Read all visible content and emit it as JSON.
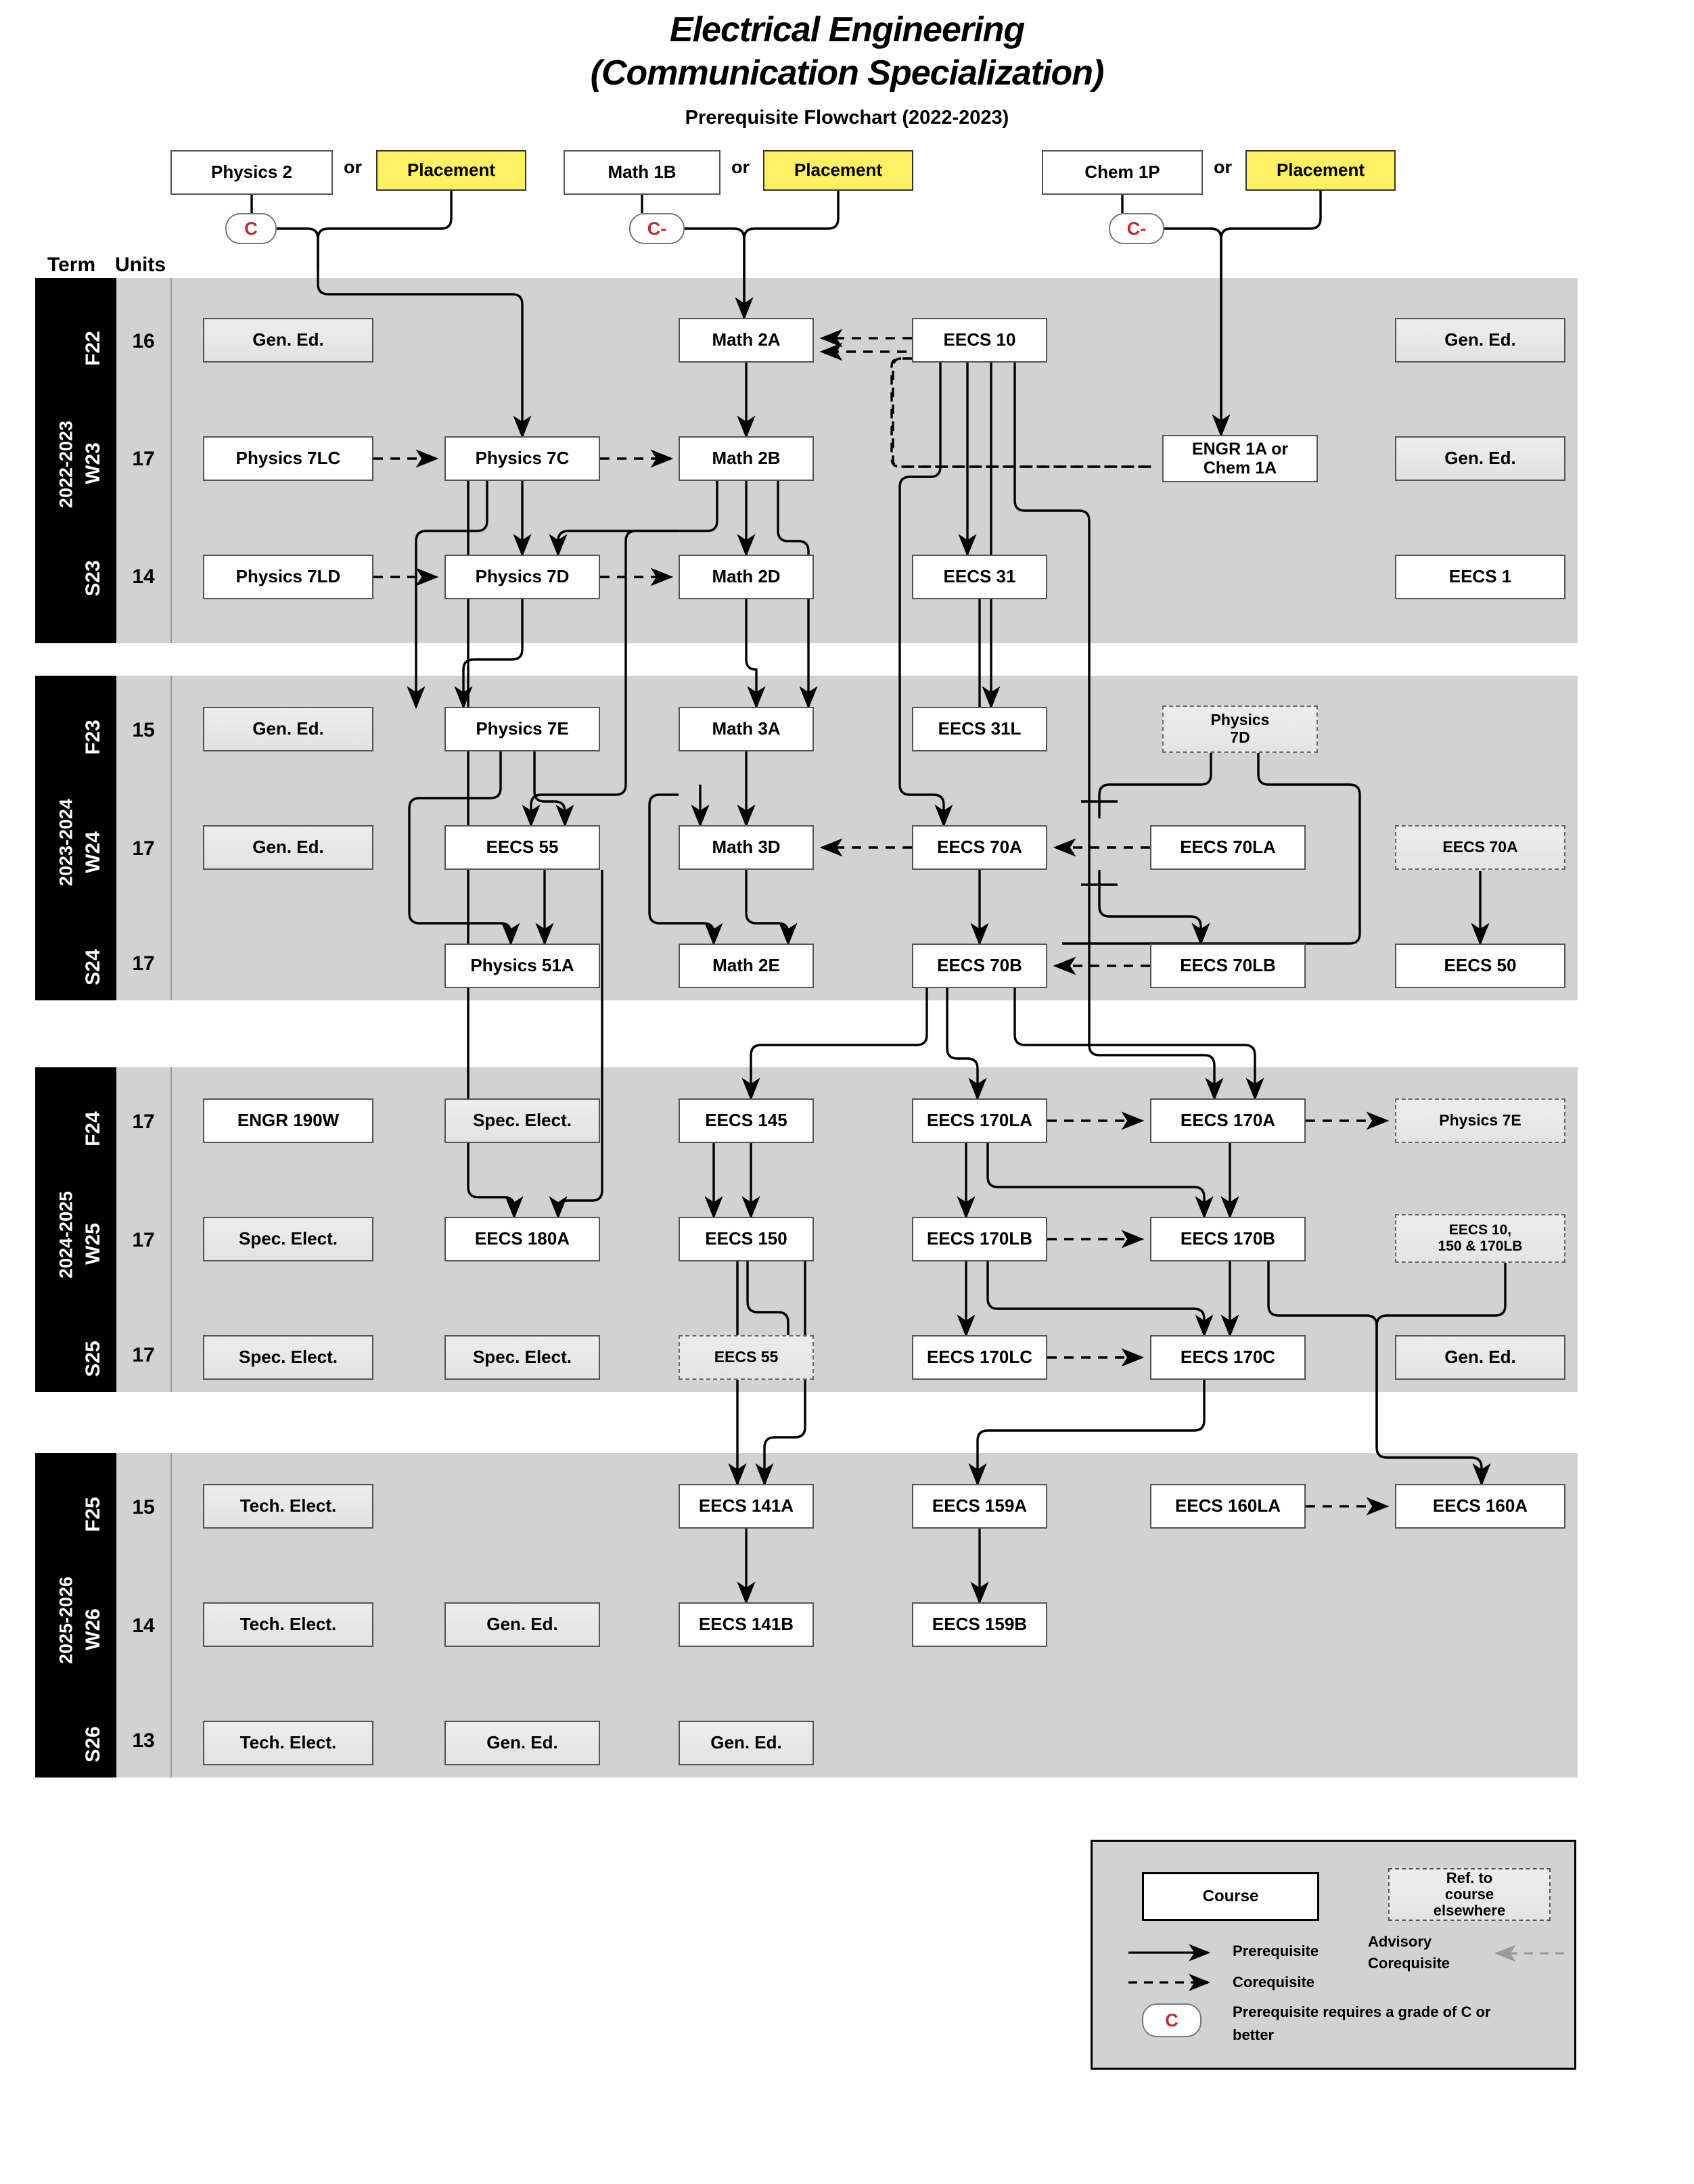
{
  "header": {
    "title_line1": "Electrical Engineering",
    "title_line2": "(Communication Specialization)",
    "subtitle": "Prerequisite Flowchart (2022-2023)",
    "term_label": "Term",
    "units_label": "Units"
  },
  "entry": {
    "or_label": "or",
    "placement_label": "Placement",
    "groups": [
      {
        "course": "Physics 2",
        "grade": "C",
        "placement": "Placement"
      },
      {
        "course": "Math 1B",
        "grade": "C-",
        "placement": "Placement"
      },
      {
        "course": "Chem 1P",
        "grade": "C-",
        "placement": "Placement"
      }
    ]
  },
  "years": [
    {
      "year_label": "2022-2023",
      "terms": [
        {
          "term": "F22",
          "units": "16",
          "courses": [
            "Gen. Ed.",
            "Math 2A",
            "EECS 10",
            "Gen. Ed."
          ]
        },
        {
          "term": "W23",
          "units": "17",
          "courses": [
            "Physics 7LC",
            "Physics 7C",
            "Math 2B",
            "ENGR 1A or Chem 1A",
            "Gen. Ed."
          ]
        },
        {
          "term": "S23",
          "units": "14",
          "courses": [
            "Physics 7LD",
            "Physics 7D",
            "Math 2D",
            "EECS 31",
            "EECS 1"
          ]
        }
      ]
    },
    {
      "year_label": "2023-2024",
      "terms": [
        {
          "term": "F23",
          "units": "15",
          "courses": [
            "Gen. Ed.",
            "Physics 7E",
            "Math 3A",
            "EECS 31L",
            "Physics 7D"
          ]
        },
        {
          "term": "W24",
          "units": "17",
          "courses": [
            "Gen. Ed.",
            "EECS 55",
            "Math 3D",
            "EECS 70A",
            "EECS 70LA",
            "EECS 70A"
          ]
        },
        {
          "term": "S24",
          "units": "17",
          "courses": [
            "Physics 51A",
            "Math 2E",
            "EECS 70B",
            "EECS 70LB",
            "EECS 50"
          ]
        }
      ]
    },
    {
      "year_label": "2024-2025",
      "terms": [
        {
          "term": "F24",
          "units": "17",
          "courses": [
            "ENGR 190W",
            "Spec. Elect.",
            "EECS 145",
            "EECS 170LA",
            "EECS 170A",
            "Physics 7E"
          ]
        },
        {
          "term": "W25",
          "units": "17",
          "courses": [
            "Spec. Elect.",
            "EECS 180A",
            "EECS 150",
            "EECS 170LB",
            "EECS 170B",
            "EECS 10, 150 & 170LB"
          ]
        },
        {
          "term": "S25",
          "units": "17",
          "courses": [
            "Spec. Elect.",
            "Spec. Elect.",
            "EECS 55",
            "EECS 170LC",
            "EECS 170C",
            "Gen. Ed."
          ]
        }
      ]
    },
    {
      "year_label": "2025-2026",
      "terms": [
        {
          "term": "F25",
          "units": "15",
          "courses": [
            "Tech. Elect.",
            "EECS 141A",
            "EECS 159A",
            "EECS 160LA",
            "EECS 160A"
          ]
        },
        {
          "term": "W26",
          "units": "14",
          "courses": [
            "Tech. Elect.",
            "Gen. Ed.",
            "EECS 141B",
            "EECS 159B"
          ]
        },
        {
          "term": "S26",
          "units": "13",
          "courses": [
            "Tech. Elect.",
            "Gen. Ed.",
            "Gen. Ed."
          ]
        }
      ]
    }
  ],
  "nodes": {
    "n_phys2": "Physics 2",
    "n_place1": "Placement",
    "n_or1": "or",
    "n_grade1": "C",
    "n_math1b": "Math 1B",
    "n_place2": "Placement",
    "n_or2": "or",
    "n_grade2": "C-",
    "n_chem1p": "Chem 1P",
    "n_place3": "Placement",
    "n_or3": "or",
    "n_grade3": "C-",
    "n_gened_f22_a": "Gen. Ed.",
    "n_math2a": "Math 2A",
    "n_eecs10": "EECS 10",
    "n_gened_f22_b": "Gen. Ed.",
    "n_phys7lc": "Physics 7LC",
    "n_phys7c": "Physics 7C",
    "n_math2b": "Math 2B",
    "n_engr1a": "ENGR 1A or\nChem 1A",
    "n_engr1a_l1": "ENGR 1A or",
    "n_engr1a_l2": "Chem 1A",
    "n_gened_w23": "Gen. Ed.",
    "n_phys7ld": "Physics 7LD",
    "n_phys7d": "Physics 7D",
    "n_math2d": "Math 2D",
    "n_eecs31": "EECS 31",
    "n_eecs1": "EECS 1",
    "n_gened_f23": "Gen. Ed.",
    "n_phys7e": "Physics 7E",
    "n_math3a": "Math 3A",
    "n_eecs31l": "EECS 31L",
    "n_ref_phys7d_l1": "Physics",
    "n_ref_phys7d_l2": "7D",
    "n_gened_w24": "Gen. Ed.",
    "n_eecs55": "EECS 55",
    "n_math3d": "Math 3D",
    "n_eecs70a": "EECS 70A",
    "n_eecs70la": "EECS 70LA",
    "n_ref_eecs70a": "EECS 70A",
    "n_phys51a": "Physics 51A",
    "n_math2e": "Math 2E",
    "n_eecs70b": "EECS 70B",
    "n_eecs70lb": "EECS 70LB",
    "n_eecs50": "EECS 50",
    "n_engr190w": "ENGR 190W",
    "n_spec_f24": "Spec. Elect.",
    "n_eecs145": "EECS 145",
    "n_eecs170la": "EECS 170LA",
    "n_eecs170a": "EECS 170A",
    "n_ref_phys7e": "Physics 7E",
    "n_spec_w25": "Spec. Elect.",
    "n_eecs180a": "EECS 180A",
    "n_eecs150": "EECS 150",
    "n_eecs170lb": "EECS 170LB",
    "n_eecs170b": "EECS 170B",
    "n_ref_eecs_10_150_l1": "EECS 10,",
    "n_ref_eecs_10_150_l2": "150 & 170LB",
    "n_spec_s25_a": "Spec. Elect.",
    "n_spec_s25_b": "Spec. Elect.",
    "n_ref_eecs55": "EECS 55",
    "n_eecs170lc": "EECS 170LC",
    "n_eecs170c": "EECS 170C",
    "n_gened_s25": "Gen. Ed.",
    "n_tech_f25": "Tech. Elect.",
    "n_eecs141a": "EECS 141A",
    "n_eecs159a": "EECS 159A",
    "n_eecs160la": "EECS 160LA",
    "n_eecs160a": "EECS 160A",
    "n_tech_w26": "Tech. Elect.",
    "n_gened_w26": "Gen. Ed.",
    "n_eecs141b": "EECS 141B",
    "n_eecs159b": "EECS 159B",
    "n_tech_s26": "Tech. Elect.",
    "n_gened_s26_a": "Gen. Ed.",
    "n_gened_s26_b": "Gen. Ed."
  },
  "terms_flat": {
    "y1": "2022-2023",
    "y2": "2023-2024",
    "y3": "2024-2025",
    "y4": "2025-2026",
    "t1": "F22",
    "t2": "W23",
    "t3": "S23",
    "t4": "F23",
    "t5": "W24",
    "t6": "S24",
    "t7": "F24",
    "t8": "W25",
    "t9": "S25",
    "t10": "F25",
    "t11": "W26",
    "t12": "S26",
    "u1": "16",
    "u2": "17",
    "u3": "14",
    "u4": "15",
    "u5": "17",
    "u6": "17",
    "u7": "17",
    "u8": "17",
    "u9": "17",
    "u10": "15",
    "u11": "14",
    "u12": "13"
  },
  "legend": {
    "course_label": "Course",
    "ref_l1": "Ref. to",
    "ref_l2": "course",
    "ref_l3": "elsewhere",
    "prereq_label": "Prerequisite",
    "coreq_label": "Corequisite",
    "advisory_l1": "Advisory",
    "advisory_l2": "Corequisite",
    "grade_symbol": "C",
    "grade_text_l1": "Prerequisite requires a grade of C or",
    "grade_text_l2": "better"
  },
  "colors": {
    "band": "#d2d2d2",
    "term_col": "#000000",
    "placement": "#ffef62",
    "grade_text": "#c1272d",
    "course_border": "#555555"
  }
}
